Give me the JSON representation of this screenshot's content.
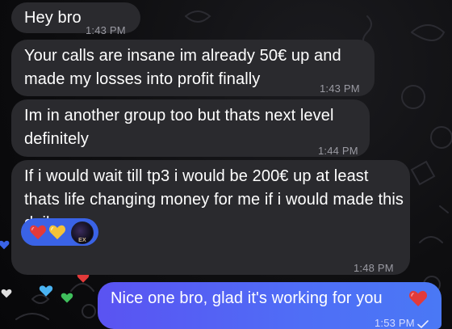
{
  "messages": [
    {
      "text": "Hey bro",
      "time": "1:43 PM",
      "direction": "incoming"
    },
    {
      "text": "Your calls are insane im already 50€ up and made my losses into profit finally",
      "time": "1:43 PM",
      "direction": "incoming"
    },
    {
      "text": "Im in another group too but thats next level definitely",
      "time": "1:44 PM",
      "direction": "incoming"
    },
    {
      "text": "If i would wait till tp3 i would be 200€ up at least thats life changing money for me if i would made this daily",
      "time": "1:48 PM",
      "direction": "incoming",
      "reactions": [
        {
          "icon": "red-heart-icon",
          "color": "#e23a3a"
        },
        {
          "icon": "yellow-heart-icon",
          "color": "#f3c338"
        }
      ],
      "reactor_avatar_label": "EX"
    },
    {
      "text": "Nice one bro, glad it's working for you",
      "emoji": "red-heart-icon",
      "time": "1:53 PM",
      "direction": "outgoing",
      "status": "read"
    }
  ],
  "colors": {
    "incoming_bubble": "#2a2a2e",
    "outgoing_bubble": "#4f6ef6",
    "reaction_pill": "#3a63e6",
    "background": "#0e0e10"
  }
}
